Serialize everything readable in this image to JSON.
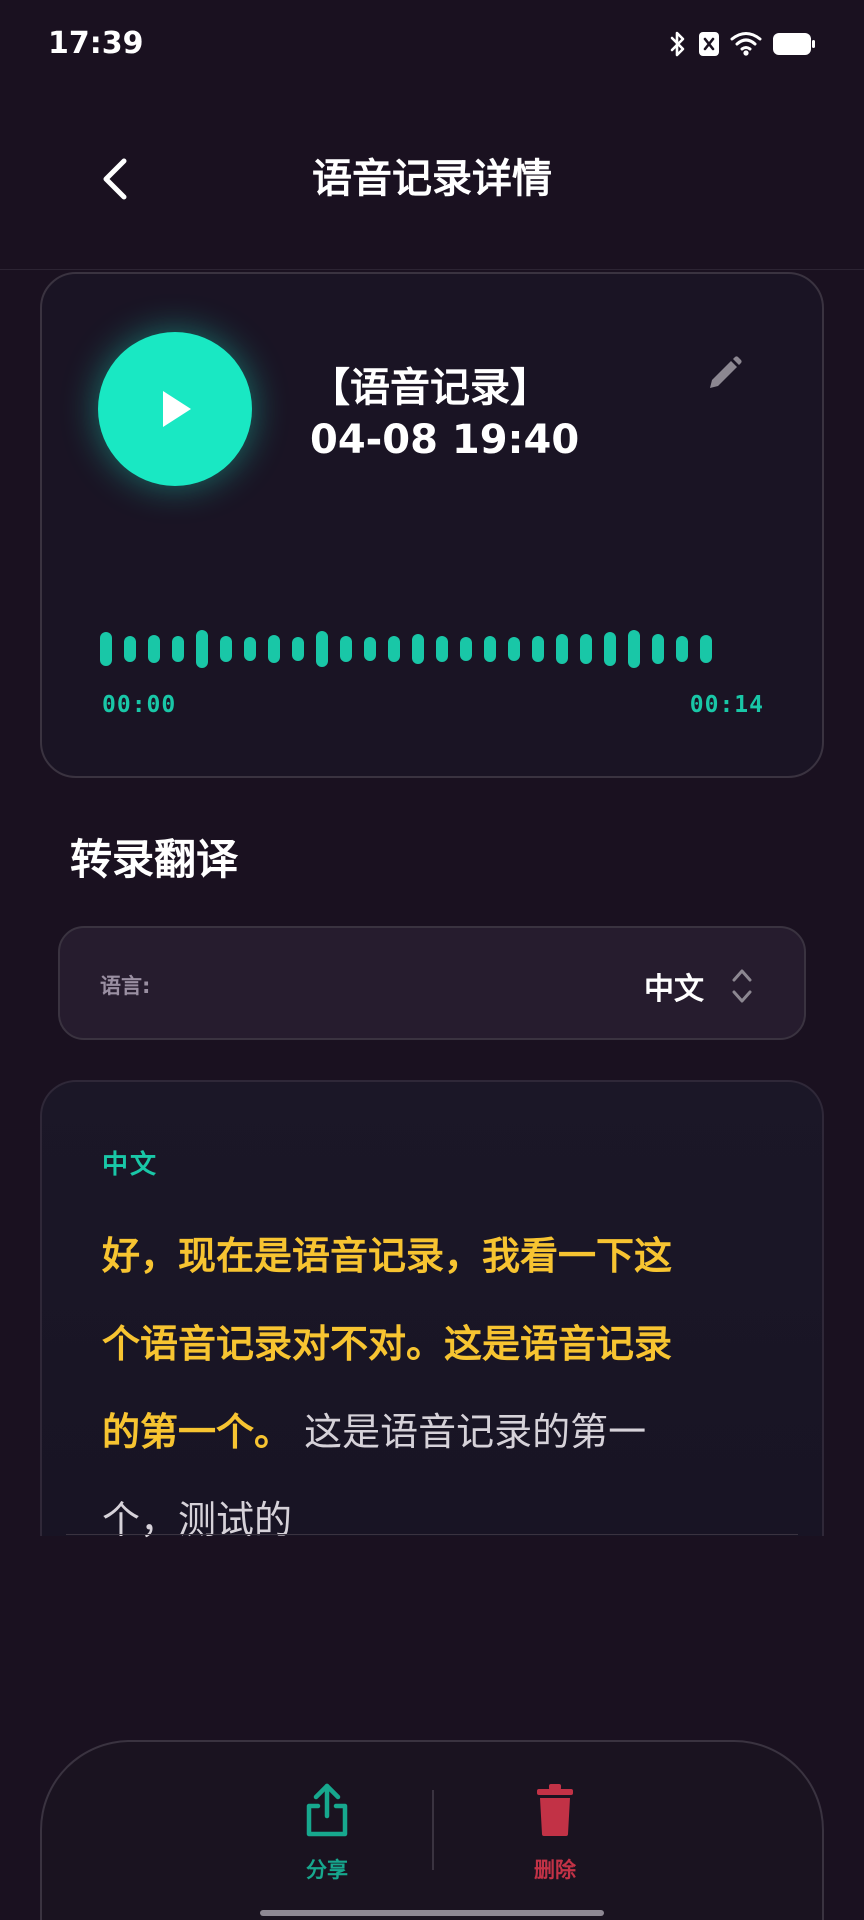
{
  "status_bar": {
    "time": "17:39"
  },
  "header": {
    "title": "语音记录详情"
  },
  "player": {
    "title_line1": "【语音记录】",
    "title_line2": "04-08 19:40",
    "time_start": "00:00",
    "time_end": "00:14",
    "accent_color": "#19e8c3"
  },
  "section": {
    "title": "转录翻译"
  },
  "language_select": {
    "label": "语言:",
    "value": "中文"
  },
  "transcript": {
    "language": "中文",
    "highlighted": "好，现在是语音记录，我看一下这个语音记录对不对。这是语音记录的第一个。",
    "normal": " 这是语音记录的第一个，测试的",
    "highlight_color": "#f7c431"
  },
  "actions": {
    "share_label": "分享",
    "delete_label": "删除"
  }
}
